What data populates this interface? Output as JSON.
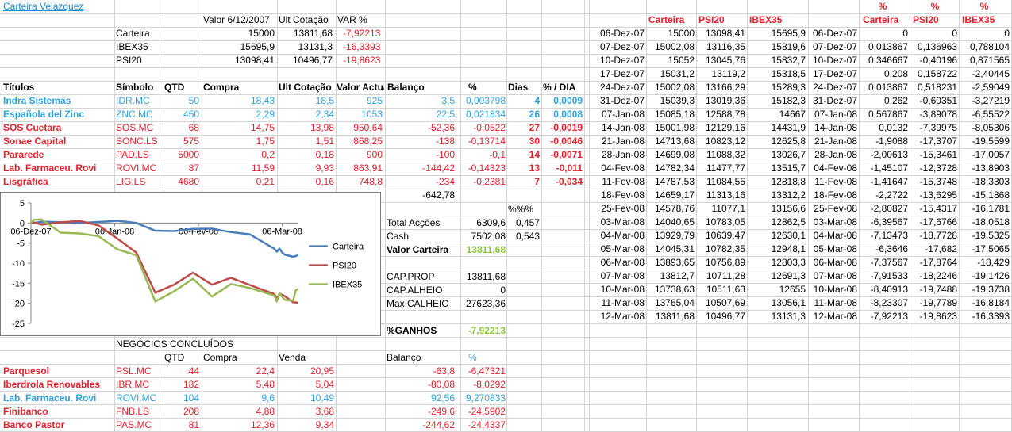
{
  "title": "Carteira Velazquez",
  "summary": {
    "headers": [
      "Valor 6/12/2007",
      "Ult Cotação",
      "VAR %"
    ],
    "rows": [
      {
        "label": "Carteira",
        "valor": "15000",
        "ult": "13811,68",
        "var": "-7,92213"
      },
      {
        "label": "IBEX35",
        "valor": "15695,9",
        "ult": "13131,3",
        "var": "-16,3393"
      },
      {
        "label": "PSI20",
        "valor": "13098,41",
        "ult": "10496,77",
        "var": "-19,8623"
      }
    ]
  },
  "positions": {
    "headers": [
      "Títulos",
      "Símbolo",
      "QTD",
      "Compra",
      "Ult Cotação",
      "Valor Actual",
      "Balanço",
      "%",
      "Dias",
      "% / DIA"
    ],
    "rows": [
      {
        "titulo": "Indra Sistemas",
        "simbolo": "IDR.MC",
        "qtd": "50",
        "compra": "18,43",
        "ult": "18,5",
        "valor": "925",
        "balanco": "3,5",
        "pct": "0,003798",
        "dias": "4",
        "pctdia": "0,0009",
        "color": "blue"
      },
      {
        "titulo": "Española del Zinc",
        "simbolo": "ZNC.MC",
        "qtd": "450",
        "compra": "2,29",
        "ult": "2,34",
        "valor": "1053",
        "balanco": "22,5",
        "pct": "0,021834",
        "dias": "26",
        "pctdia": "0,0008",
        "color": "blue"
      },
      {
        "titulo": "SOS Cuetara",
        "simbolo": "SOS.MC",
        "qtd": "68",
        "compra": "14,75",
        "ult": "13,98",
        "valor": "950,64",
        "balanco": "-52,36",
        "pct": "-0,0522",
        "dias": "27",
        "pctdia": "-0,0019",
        "color": "red"
      },
      {
        "titulo": "Sonae Capital",
        "simbolo": "SONC.LS",
        "qtd": "575",
        "compra": "1,75",
        "ult": "1,51",
        "valor": "868,25",
        "balanco": "-138",
        "pct": "-0,13714",
        "dias": "30",
        "pctdia": "-0,0046",
        "color": "red"
      },
      {
        "titulo": "Pararede",
        "simbolo": "PAD.LS",
        "qtd": "5000",
        "compra": "0,2",
        "ult": "0,18",
        "valor": "900",
        "balanco": "-100",
        "pct": "-0,1",
        "dias": "14",
        "pctdia": "-0,0071",
        "color": "red"
      },
      {
        "titulo": "Lab. Farmaceu. Rovi",
        "simbolo": "ROVI.MC",
        "qtd": "87",
        "compra": "11,59",
        "ult": "9,93",
        "valor": "863,91",
        "balanco": "-144,42",
        "pct": "-0,14323",
        "dias": "13",
        "pctdia": "-0,011",
        "color": "red"
      },
      {
        "titulo": "Lisgráfica",
        "simbolo": "LIG.LS",
        "qtd": "4680",
        "compra": "0,21",
        "ult": "0,16",
        "valor": "748,8",
        "balanco": "-234",
        "pct": "-0,2381",
        "dias": "7",
        "pctdia": "-0,034",
        "color": "red"
      }
    ],
    "total_balanco": "-642,78"
  },
  "totals": {
    "pct_label": "%%%",
    "total_accoes_label": "Total Acções",
    "total_accoes": "6309,6",
    "total_accoes_pct": "0,457",
    "cash_label": "Cash",
    "cash": "7502,08",
    "cash_pct": "0,543",
    "valor_carteira_label": "Valor Carteira",
    "valor_carteira": "13811,68",
    "cap_prop_label": "CAP.PROP",
    "cap_prop": "13811,68",
    "cap_alheio_label": "CAP.ALHEIO",
    "cap_alheio": "0",
    "max_calheio_label": "Max CALHEIO",
    "max_calheio": "27623,36",
    "ganhos_label": "%GANHOS",
    "ganhos": "-7,92213"
  },
  "negocios": {
    "title": "NEGÓCIOS CONCLUÍDOS",
    "headers": [
      "QTD",
      "Compra",
      "Venda",
      "Balanço",
      "%"
    ],
    "rows": [
      {
        "titulo": "Parquesol",
        "simbolo": "PSL.MC",
        "qtd": "44",
        "compra": "22,4",
        "venda": "20,95",
        "balanco": "-63,8",
        "pct": "-6,47321",
        "color": "red"
      },
      {
        "titulo": "Iberdrola Renovables",
        "simbolo": "IBR.MC",
        "qtd": "182",
        "compra": "5,48",
        "venda": "5,04",
        "balanco": "-80,08",
        "pct": "-8,0292",
        "color": "red"
      },
      {
        "titulo": "Lab. Farmaceu. Rovi",
        "simbolo": "ROVI.MC",
        "qtd": "104",
        "compra": "9,6",
        "venda": "10,49",
        "balanco": "92,56",
        "pct": "9,270833",
        "color": "blue"
      },
      {
        "titulo": "Finibanco",
        "simbolo": "FNB.LS",
        "qtd": "208",
        "compra": "4,88",
        "venda": "3,68",
        "balanco": "-249,6",
        "pct": "-24,5902",
        "color": "red"
      },
      {
        "titulo": "Banco Pastor",
        "simbolo": "PAS.MC",
        "qtd": "81",
        "compra": "12,36",
        "venda": "9,34",
        "balanco": "-244,62",
        "pct": "-24,4337",
        "color": "red"
      }
    ]
  },
  "history": {
    "headers": [
      "Carteira",
      "PSI20",
      "IBEX35"
    ],
    "rows": [
      {
        "date": "06-Dez-07",
        "carteira": "15000",
        "psi20": "13098,41",
        "ibex35": "15695,9"
      },
      {
        "date": "07-Dez-07",
        "carteira": "15002,08",
        "psi20": "13116,35",
        "ibex35": "15819,6"
      },
      {
        "date": "10-Dez-07",
        "carteira": "15052",
        "psi20": "13045,76",
        "ibex35": "15832,7"
      },
      {
        "date": "17-Dez-07",
        "carteira": "15031,2",
        "psi20": "13119,2",
        "ibex35": "15318,5"
      },
      {
        "date": "24-Dez-07",
        "carteira": "15002,08",
        "psi20": "13166,29",
        "ibex35": "15289,3"
      },
      {
        "date": "31-Dez-07",
        "carteira": "15039,3",
        "psi20": "13019,36",
        "ibex35": "15182,3"
      },
      {
        "date": "07-Jan-08",
        "carteira": "15085,18",
        "psi20": "12588,78",
        "ibex35": "14667"
      },
      {
        "date": "14-Jan-08",
        "carteira": "15001,98",
        "psi20": "12129,16",
        "ibex35": "14431,9"
      },
      {
        "date": "21-Jan-08",
        "carteira": "14713,68",
        "psi20": "10823,12",
        "ibex35": "12625,8"
      },
      {
        "date": "28-Jan-08",
        "carteira": "14699,08",
        "psi20": "11088,32",
        "ibex35": "13026,7"
      },
      {
        "date": "04-Fev-08",
        "carteira": "14782,34",
        "psi20": "11477,77",
        "ibex35": "13515,7"
      },
      {
        "date": "11-Fev-08",
        "carteira": "14787,53",
        "psi20": "11084,55",
        "ibex35": "12818,8"
      },
      {
        "date": "18-Fev-08",
        "carteira": "14659,17",
        "psi20": "11313,16",
        "ibex35": "13312,2"
      },
      {
        "date": "25-Fev-08",
        "carteira": "14578,76",
        "psi20": "11077,1",
        "ibex35": "13156,6"
      },
      {
        "date": "03-Mar-08",
        "carteira": "14040,65",
        "psi20": "10783,05",
        "ibex35": "12862,5"
      },
      {
        "date": "04-Mar-08",
        "carteira": "13929,79",
        "psi20": "10639,47",
        "ibex35": "12630,1"
      },
      {
        "date": "05-Mar-08",
        "carteira": "14045,31",
        "psi20": "10782,35",
        "ibex35": "12948,1"
      },
      {
        "date": "06-Mar-08",
        "carteira": "13893,65",
        "psi20": "10756,89",
        "ibex35": "12803,3"
      },
      {
        "date": "07-Mar-08",
        "carteira": "13812,7",
        "psi20": "10711,28",
        "ibex35": "12691,3"
      },
      {
        "date": "10-Mar-08",
        "carteira": "13738,63",
        "psi20": "10511,63",
        "ibex35": "12655"
      },
      {
        "date": "11-Mar-08",
        "carteira": "13765,04",
        "psi20": "10507,69",
        "ibex35": "13056,1"
      },
      {
        "date": "12-Mar-08",
        "carteira": "13811,68",
        "psi20": "10496,77",
        "ibex35": "13131,3"
      }
    ]
  },
  "variation": {
    "pct_label": "%",
    "headers": [
      "Carteira",
      "PSI20",
      "IBEX35"
    ],
    "rows": [
      {
        "date": "06-Dez-07",
        "carteira": "0",
        "psi20": "0",
        "ibex35": "0"
      },
      {
        "date": "07-Dez-07",
        "carteira": "0,013867",
        "psi20": "0,136963",
        "ibex35": "0,788104"
      },
      {
        "date": "10-Dez-07",
        "carteira": "0,346667",
        "psi20": "-0,40196",
        "ibex35": "0,871565"
      },
      {
        "date": "17-Dez-07",
        "carteira": "0,208",
        "psi20": "0,158722",
        "ibex35": "-2,40445"
      },
      {
        "date": "24-Dez-07",
        "carteira": "0,013867",
        "psi20": "0,518231",
        "ibex35": "-2,59049"
      },
      {
        "date": "31-Dez-07",
        "carteira": "0,262",
        "psi20": "-0,60351",
        "ibex35": "-3,27219"
      },
      {
        "date": "07-Jan-08",
        "carteira": "0,567867",
        "psi20": "-3,89078",
        "ibex35": "-6,55522"
      },
      {
        "date": "14-Jan-08",
        "carteira": "0,0132",
        "psi20": "-7,39975",
        "ibex35": "-8,05306"
      },
      {
        "date": "21-Jan-08",
        "carteira": "-1,9088",
        "psi20": "-17,3707",
        "ibex35": "-19,5599"
      },
      {
        "date": "28-Jan-08",
        "carteira": "-2,00613",
        "psi20": "-15,3461",
        "ibex35": "-17,0057"
      },
      {
        "date": "04-Fev-08",
        "carteira": "-1,45107",
        "psi20": "-12,3728",
        "ibex35": "-13,8903"
      },
      {
        "date": "11-Fev-08",
        "carteira": "-1,41647",
        "psi20": "-15,3748",
        "ibex35": "-18,3303"
      },
      {
        "date": "18-Fev-08",
        "carteira": "-2,2722",
        "psi20": "-13,6295",
        "ibex35": "-15,1868"
      },
      {
        "date": "25-Fev-08",
        "carteira": "-2,80827",
        "psi20": "-15,4317",
        "ibex35": "-16,1781"
      },
      {
        "date": "03-Mar-08",
        "carteira": "-6,39567",
        "psi20": "-17,6766",
        "ibex35": "-18,0518"
      },
      {
        "date": "04-Mar-08",
        "carteira": "-7,13473",
        "psi20": "-18,7728",
        "ibex35": "-19,5325"
      },
      {
        "date": "05-Mar-08",
        "carteira": "-6,3646",
        "psi20": "-17,682",
        "ibex35": "-17,5065"
      },
      {
        "date": "06-Mar-08",
        "carteira": "-7,37567",
        "psi20": "-17,8764",
        "ibex35": "-18,429"
      },
      {
        "date": "07-Mar-08",
        "carteira": "-7,91533",
        "psi20": "-18,2246",
        "ibex35": "-19,1426"
      },
      {
        "date": "10-Mar-08",
        "carteira": "-8,40913",
        "psi20": "-19,7488",
        "ibex35": "-19,3738"
      },
      {
        "date": "11-Mar-08",
        "carteira": "-8,23307",
        "psi20": "-19,7789",
        "ibex35": "-16,8184"
      },
      {
        "date": "12-Mar-08",
        "carteira": "-7,92213",
        "psi20": "-19,8623",
        "ibex35": "-16,3393"
      }
    ]
  },
  "chart_data": {
    "type": "line",
    "title": "",
    "x": [
      "06-Dez-07",
      "07-Dez-07",
      "10-Dez-07",
      "17-Dez-07",
      "24-Dez-07",
      "31-Dez-07",
      "07-Jan-08",
      "14-Jan-08",
      "21-Jan-08",
      "28-Jan-08",
      "04-Fev-08",
      "11-Fev-08",
      "18-Fev-08",
      "25-Fev-08",
      "03-Mar-08",
      "04-Mar-08",
      "05-Mar-08",
      "06-Mar-08",
      "07-Mar-08",
      "10-Mar-08",
      "11-Mar-08",
      "12-Mar-08"
    ],
    "x_ticks": [
      "06-Dez-07",
      "06-Jan-08",
      "06-Fev-08",
      "06-Mar-08"
    ],
    "ylim": [
      -25,
      5
    ],
    "y_ticks": [
      5,
      0,
      -5,
      -10,
      -15,
      -20,
      -25
    ],
    "legend_position": "right",
    "series": [
      {
        "name": "Carteira",
        "color": "#4a7ebb",
        "values": [
          0,
          0.014,
          0.347,
          0.208,
          0.014,
          0.262,
          0.568,
          0.013,
          -1.909,
          -2.006,
          -1.451,
          -1.416,
          -2.272,
          -2.808,
          -6.396,
          -7.135,
          -6.365,
          -7.376,
          -7.915,
          -8.409,
          -8.233,
          -7.922
        ]
      },
      {
        "name": "PSI20",
        "color": "#be4b48",
        "values": [
          0,
          0.137,
          -0.402,
          0.159,
          0.518,
          -0.604,
          -3.891,
          -7.4,
          -17.371,
          -15.346,
          -12.373,
          -15.375,
          -13.63,
          -15.432,
          -17.677,
          -18.773,
          -17.682,
          -17.876,
          -18.225,
          -19.749,
          -19.779,
          -19.862
        ]
      },
      {
        "name": "IBEX35",
        "color": "#98b954",
        "values": [
          0,
          0.788,
          0.872,
          -2.404,
          -2.59,
          -3.272,
          -6.555,
          -8.053,
          -19.56,
          -17.006,
          -13.89,
          -18.33,
          -15.187,
          -16.178,
          -18.052,
          -19.533,
          -17.507,
          -18.429,
          -19.143,
          -19.374,
          -16.818,
          -16.339
        ]
      }
    ]
  }
}
